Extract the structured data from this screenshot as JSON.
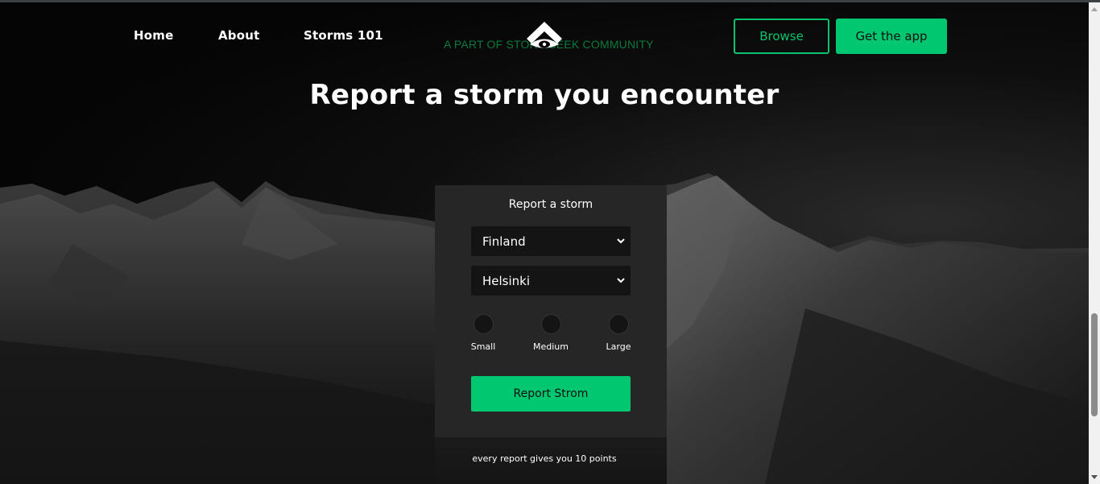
{
  "nav": {
    "items": [
      {
        "label": "Home"
      },
      {
        "label": "About"
      },
      {
        "label": "Storms 101"
      }
    ]
  },
  "brand": {
    "logo_icon": "storm-eye-logo-icon",
    "tagline": "A PART OF STORMGEEK COMMUNITY"
  },
  "header_actions": {
    "browse_label": "Browse",
    "get_app_label": "Get the app"
  },
  "hero": {
    "title": "Report a storm you encounter"
  },
  "report_form": {
    "title": "Report a storm",
    "country_select": {
      "value": "Finland"
    },
    "city_select": {
      "value": "Helsinki"
    },
    "sizes": [
      {
        "label": "Small"
      },
      {
        "label": "Medium"
      },
      {
        "label": "Large"
      }
    ],
    "submit_label": "Report Strom"
  },
  "footnote": "every report gives you 10 points",
  "colors": {
    "accent": "#00c770",
    "card": "#262626",
    "input": "#141414",
    "tagline": "#0a7a3b"
  }
}
